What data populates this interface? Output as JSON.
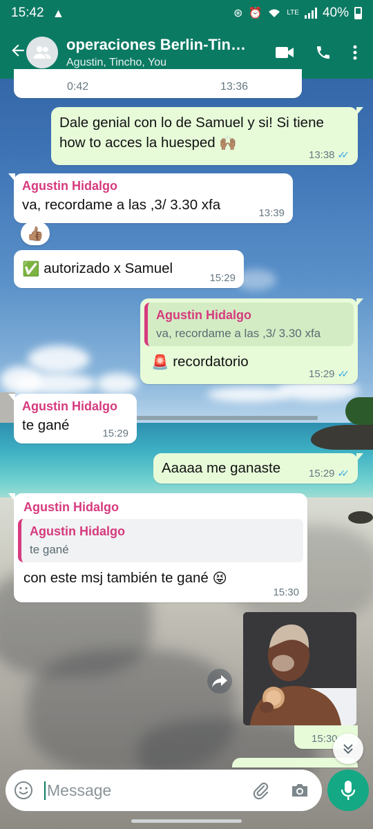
{
  "status_bar": {
    "time": "15:42",
    "battery": "40%",
    "network": "LTE"
  },
  "header": {
    "title": "operaciones Berlin-Tin…",
    "subtitle": "Agustin, Tincho, You",
    "icons": [
      "back-arrow-icon",
      "group-avatar-icon",
      "video-call-icon",
      "phone-call-icon",
      "more-vertical-icon"
    ]
  },
  "messages": {
    "m0": {
      "duration": "0:42",
      "time": "13:36"
    },
    "m1": {
      "text": "Dale genial con lo de Samuel y si! Si tiene how to acces la huesped",
      "emoji": "🙌🏽",
      "time": "13:38"
    },
    "m2": {
      "sender": "Agustin Hidalgo",
      "text": "va, recordame a las ,3/ 3.30 xfa",
      "time": "13:39",
      "reaction": "👍🏽"
    },
    "m3": {
      "emoji": "✅",
      "text": "autorizado x Samuel",
      "time": "15:29"
    },
    "m4": {
      "quote_sender": "Agustin Hidalgo",
      "quote_text": "va, recordame a las ,3/ 3.30 xfa",
      "emoji": "🚨",
      "text": "recordatorio",
      "time": "15:29"
    },
    "m5": {
      "sender": "Agustin Hidalgo",
      "text": "te gané",
      "time": "15:29"
    },
    "m6": {
      "text": "Aaaaa me ganaste",
      "time": "15:29"
    },
    "m7": {
      "sender": "Agustin Hidalgo",
      "quote_sender": "Agustin Hidalgo",
      "quote_text": "te gané",
      "text": "con este msj también te gané",
      "emoji": "😝",
      "time": "15:30"
    },
    "m8": {
      "time": "15:30"
    }
  },
  "composer": {
    "placeholder": "Message",
    "icons": [
      "emoji-icon",
      "attach-icon",
      "camera-icon",
      "mic-icon"
    ]
  },
  "colors": {
    "header": "#0b7a63",
    "outgoing_bubble": "#e7fbd9",
    "incoming_bubble": "#ffffff",
    "sender_name": "#d63a7e",
    "read_tick": "#34a5e5",
    "mic_button": "#14a884"
  }
}
